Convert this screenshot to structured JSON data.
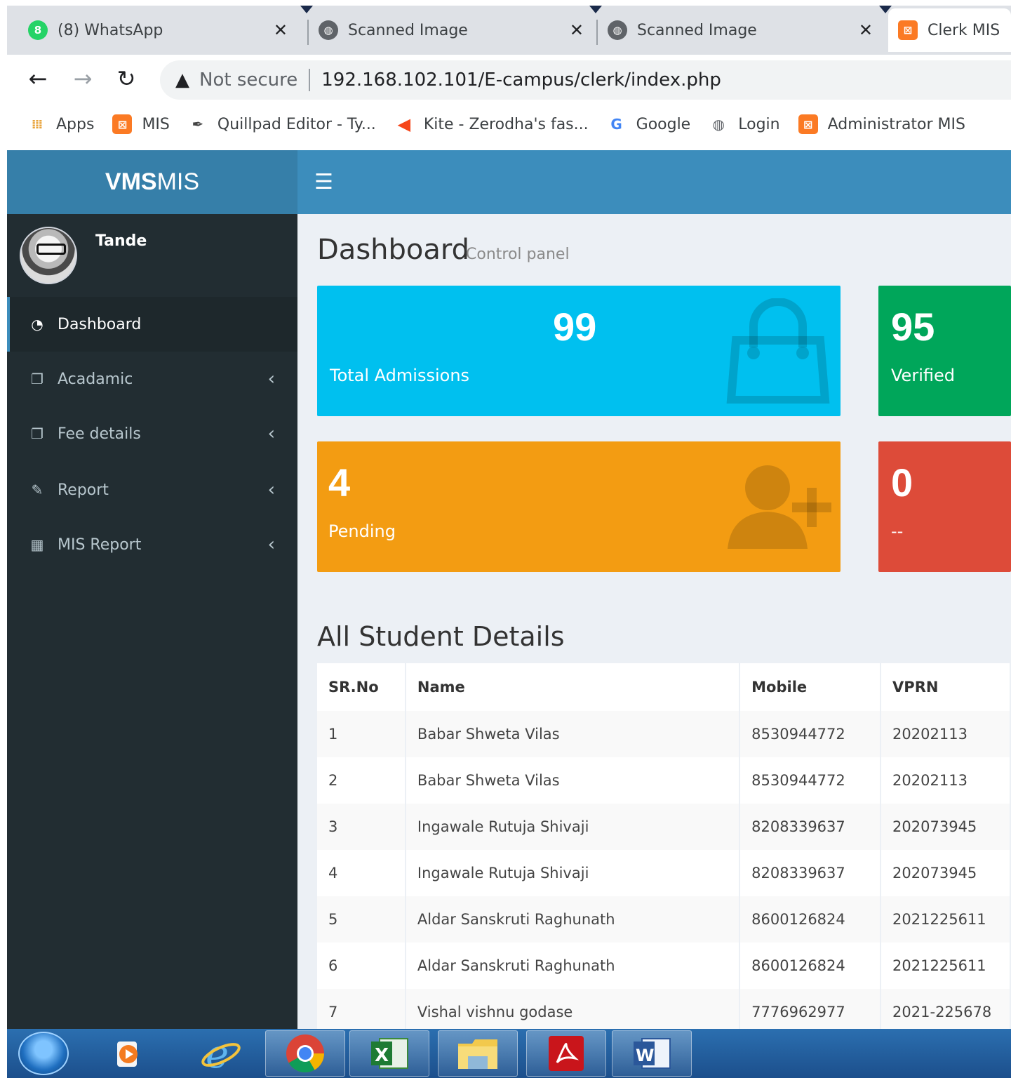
{
  "browser": {
    "tabs": [
      {
        "title": "(8) WhatsApp",
        "icon": "whatsapp-icon",
        "badge": "8"
      },
      {
        "title": "Scanned Image",
        "icon": "globe-icon"
      },
      {
        "title": "Scanned Image",
        "icon": "globe-icon"
      },
      {
        "title": "Clerk MIS",
        "icon": "xampp-icon"
      }
    ],
    "security_label": "Not secure",
    "url": "192.168.102.101/E-campus/clerk/index.php",
    "bookmarks": [
      {
        "label": "Apps",
        "icon": "apps-grid-icon"
      },
      {
        "label": "MIS",
        "icon": "xampp-icon"
      },
      {
        "label": "Quillpad Editor - Ty...",
        "icon": "quill-icon"
      },
      {
        "label": "Kite - Zerodha's fas...",
        "icon": "kite-icon"
      },
      {
        "label": "Google",
        "icon": "google-icon"
      },
      {
        "label": "Login",
        "icon": "globe-icon"
      },
      {
        "label": "Administrator MIS",
        "icon": "xampp-icon"
      }
    ]
  },
  "app": {
    "logo_bold": "VMS",
    "logo_regular": "MIS",
    "user_name": "Tande",
    "menu": [
      {
        "label": "Dashboard",
        "icon": "dashboard-icon"
      },
      {
        "label": "Acadamic",
        "icon": "copy-icon"
      },
      {
        "label": "Fee details",
        "icon": "copy-icon"
      },
      {
        "label": "Report",
        "icon": "edit-icon"
      },
      {
        "label": "MIS Report",
        "icon": "table-icon"
      }
    ],
    "page_title": "Dashboard",
    "page_subtitle": "Control panel",
    "boxes": [
      {
        "value": "99",
        "label": "Total Admissions",
        "color": "#00c0ef",
        "icon": "shopping-bag-icon"
      },
      {
        "value": "95",
        "label": "Verified",
        "color": "#00a65a"
      },
      {
        "value": "4",
        "label": "Pending",
        "color": "#f39c12",
        "icon": "user-plus-icon"
      },
      {
        "value": "0",
        "label": "--",
        "color": "#dd4b39"
      }
    ],
    "table_title": "All Student Details",
    "table": {
      "headers": [
        "SR.No",
        "Name",
        "Mobile",
        "VPRN"
      ],
      "rows": [
        [
          "1",
          "Babar Shweta Vilas",
          "8530944772",
          "20202113"
        ],
        [
          "2",
          "Babar Shweta Vilas",
          "8530944772",
          "20202113"
        ],
        [
          "3",
          "Ingawale Rutuja Shivaji",
          "8208339637",
          "202073945"
        ],
        [
          "4",
          "Ingawale Rutuja Shivaji",
          "8208339637",
          "202073945"
        ],
        [
          "5",
          "Aldar Sanskruti Raghunath",
          "8600126824",
          "2021225611"
        ],
        [
          "6",
          "Aldar Sanskruti Raghunath",
          "8600126824",
          "2021225611"
        ],
        [
          "7",
          "Vishal vishnu godase",
          "7776962977",
          "2021-225678"
        ]
      ]
    }
  },
  "taskbar": {
    "items": [
      "start-orb-icon",
      "media-player-icon",
      "internet-explorer-icon",
      "chrome-icon",
      "excel-icon",
      "file-explorer-icon",
      "acrobat-icon",
      "word-icon"
    ]
  }
}
